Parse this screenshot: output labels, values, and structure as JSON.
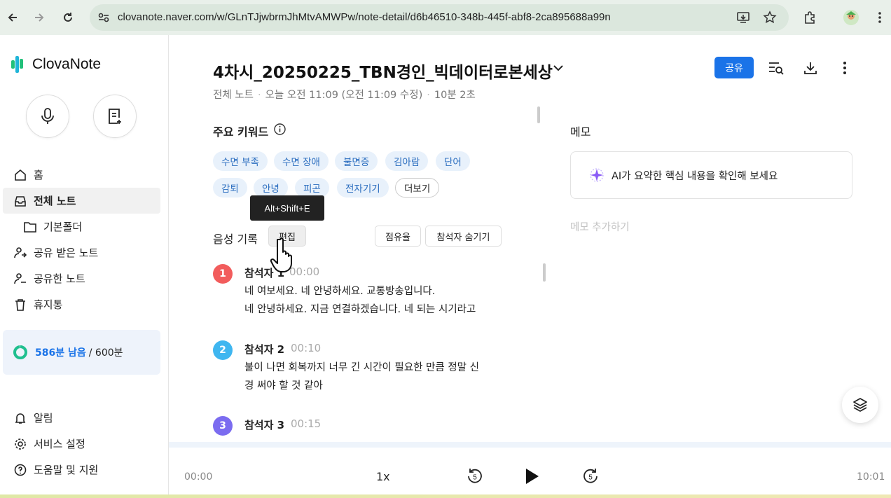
{
  "browser": {
    "url": "clovanote.naver.com/w/GLnTJjwbrmJhMtvAMWPw/note-detail/d6b46510-348b-445f-abf8-2ca895688a99n"
  },
  "sidebar": {
    "logo": "ClovaNote",
    "items": [
      {
        "label": "홈",
        "icon": "home-icon"
      },
      {
        "label": "전체 노트",
        "icon": "inbox-icon"
      },
      {
        "label": "기본폴더",
        "icon": "folder-icon"
      },
      {
        "label": "공유 받은 노트",
        "icon": "shared-in-icon"
      },
      {
        "label": "공유한 노트",
        "icon": "shared-out-icon"
      },
      {
        "label": "휴지통",
        "icon": "trash-icon"
      }
    ],
    "quota": {
      "remaining": "586분 남음",
      "total": "/ 600분",
      "fraction": 0.977
    },
    "bottom_items": [
      {
        "label": "알림",
        "icon": "bell-icon"
      },
      {
        "label": "서비스 설정",
        "icon": "gear-icon"
      },
      {
        "label": "도움말 및 지원",
        "icon": "help-icon"
      }
    ]
  },
  "note": {
    "title": "4차시_20250225_TBN경인_빅데이터로본세상",
    "meta_folder": "전체 노트",
    "meta_modified": "오늘 오전 11:09 (오전 11:09 수정)",
    "meta_duration": "10분 2초",
    "share_label": "공유"
  },
  "keywords": {
    "title": "주요 키워드",
    "chips": [
      "수면 부족",
      "수면 장애",
      "불면증",
      "김아람",
      "단어",
      "감퇴",
      "안녕",
      "피곤",
      "전자기기"
    ],
    "more_label": "더보기",
    "tooltip": "Alt+Shift+E"
  },
  "record": {
    "title": "음성 기록",
    "edit_label": "편집",
    "share_rate_label": "점유율",
    "hide_speakers_label": "참석자 숨기기",
    "speakers": [
      {
        "num": "1",
        "name": "참석자 1",
        "time": "00:00",
        "color": "#f25c5c",
        "lines": [
          "네 여보세요. 네 안녕하세요. 교통방송입니다.",
          "네 안녕하세요. 지금 연결하겠습니다. 네 되는 시기라고"
        ]
      },
      {
        "num": "2",
        "name": "참석자 2",
        "time": "00:10",
        "color": "#3fb6f0",
        "lines": [
          "불이 나면 회복까지 너무 긴 시간이 필요한 만큼 정말 신",
          "경 써야 할 것 같아"
        ]
      },
      {
        "num": "3",
        "name": "참석자 3",
        "time": "00:15",
        "color": "#7b6cf0",
        "lines": []
      }
    ]
  },
  "memo": {
    "title": "메모",
    "ai_summary": "AI가 요약한 핵심 내용을 확인해 보세요",
    "add_placeholder": "메모 추가하기"
  },
  "player": {
    "current_time": "00:00",
    "speed": "1x",
    "rewind": "5",
    "forward": "5",
    "total_time": "10:01"
  }
}
